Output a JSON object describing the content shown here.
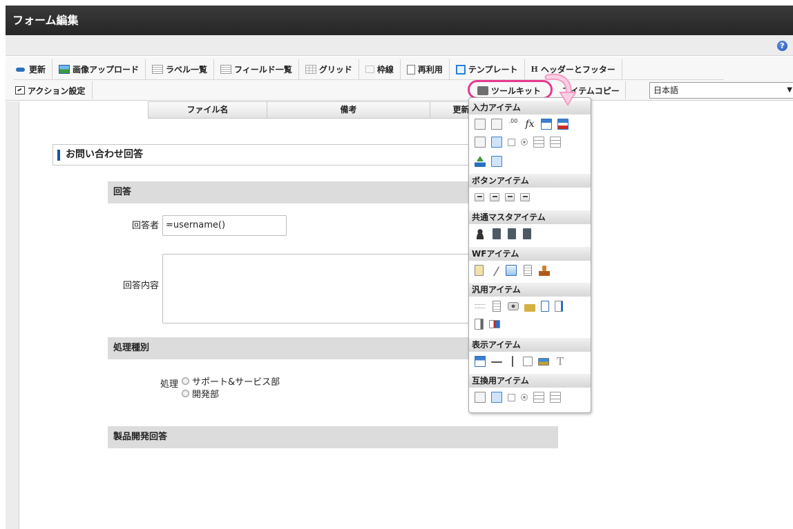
{
  "window": {
    "title": "フォーム編集"
  },
  "help": {
    "glyph": "?"
  },
  "toolbar": {
    "row1": [
      {
        "label": "更新",
        "icon": "refresh-icon"
      },
      {
        "label": "画像アップロード",
        "icon": "image-upload-icon"
      },
      {
        "label": "ラベル一覧",
        "icon": "label-list-icon"
      },
      {
        "label": "フィールド一覧",
        "icon": "field-list-icon"
      },
      {
        "label": "グリッド",
        "icon": "grid-icon"
      },
      {
        "label": "枠線",
        "icon": "frame-icon"
      },
      {
        "label": "再利用",
        "icon": "reuse-icon"
      },
      {
        "label": "テンプレート",
        "icon": "template-icon"
      },
      {
        "label": "ヘッダーとフッター",
        "icon": "header-footer-icon",
        "glyph": "H"
      }
    ],
    "action_label": "アクション設定",
    "toolkit_label": "ツールキット",
    "copy_label": "アイテムコピー",
    "language": {
      "value": "日本語",
      "arrow": "▼"
    }
  },
  "file_table": {
    "headers": [
      "ファイル名",
      "備考",
      "更新"
    ]
  },
  "form": {
    "section_title": "お問い合わせ回答",
    "bands": {
      "answer": "回答",
      "process_type": "処理種別",
      "product_dev": "製品開発回答"
    },
    "respondent_label": "回答者",
    "respondent_value": "=username()",
    "content_label": "回答内容",
    "process_label": "処理",
    "radio_options": [
      "サポート&サービス部",
      "開発部"
    ]
  },
  "toolkit_popup": {
    "categories": {
      "input": "入力アイテム",
      "button": "ボタンアイテム",
      "common_master": "共通マスタアイテム",
      "wf": "WFアイテム",
      "general": "汎用アイテム",
      "display": "表示アイテム",
      "compat": "互換用アイテム"
    },
    "fx_glyph": "fx",
    "number_glyph": ".00",
    "text_glyph": "T"
  },
  "colors": {
    "highlight": "#e6398f",
    "arrow": "#f7a8cf",
    "title_bar": "#2e2e2e",
    "accent": "#1a52a8"
  }
}
